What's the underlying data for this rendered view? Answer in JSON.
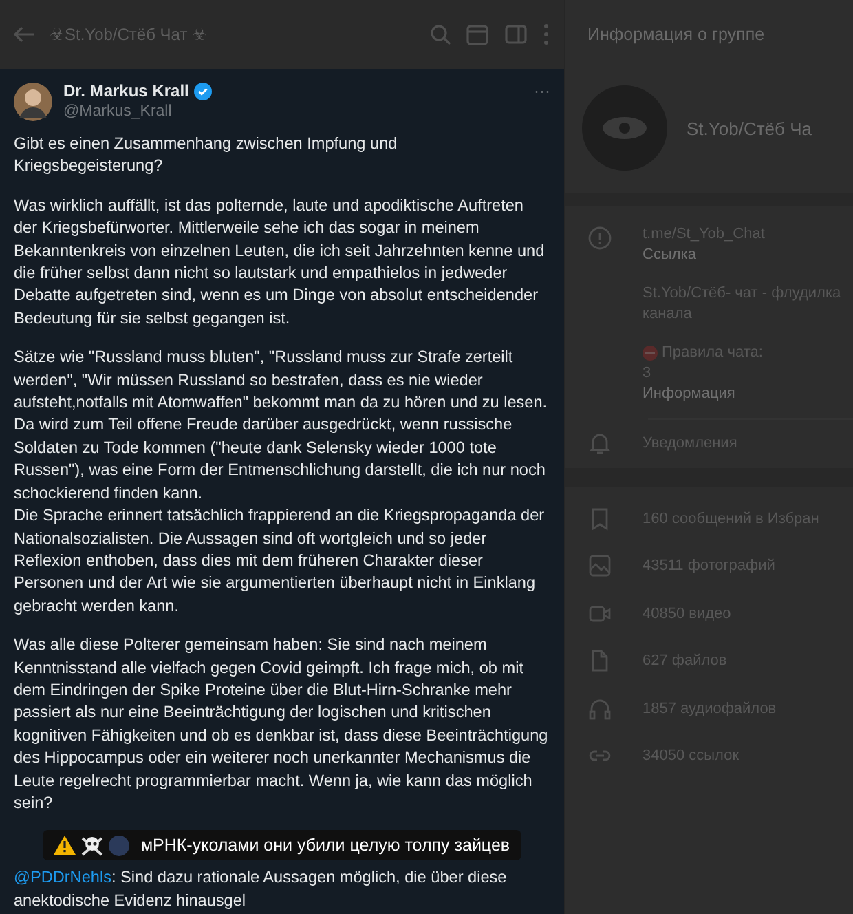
{
  "chat_header": {
    "title": "☣St.Yob/Стёб Чат ☣"
  },
  "tweet": {
    "author": "Dr. Markus Krall",
    "handle": "@Markus_Krall",
    "verified": true,
    "more": "···",
    "paragraphs": [
      "Gibt es einen Zusammenhang zwischen Impfung und Kriegsbegeisterung?",
      "Was wirklich auffällt, ist das polternde, laute und apodiktische Auftreten der Kriegsbefürworter. Mittlerweile sehe ich das sogar in meinem Bekanntenkreis von einzelnen Leuten, die ich seit Jahrzehnten kenne und die früher selbst dann nicht so lautstark und empathielos in jedweder Debatte aufgetreten sind, wenn es um Dinge von absolut entscheidender Bedeutung für sie selbst gegangen ist.",
      "Sätze wie \"Russland muss bluten\", \"Russland muss zur Strafe zerteilt werden\", \"Wir müssen Russland so bestrafen, dass es nie wieder aufsteht,notfalls mit Atomwaffen\" bekommt man da zu hören und zu lesen.\nDa wird zum Teil offene Freude darüber ausgedrückt, wenn russische Soldaten zu Tode kommen (\"heute dank Selensky wieder 1000 tote Russen\"), was eine Form der Entmenschlichung darstellt, die ich nur noch schockierend finden kann.\nDie Sprache erinnert tatsächlich frappierend an die Kriegspropaganda der Nationalsozialisten. Die Aussagen sind oft wortgleich und so jeder Reflexion enthoben, dass dies mit dem früheren Charakter dieser Personen und der Art wie sie argumentierten überhaupt nicht in Einklang gebracht werden kann.",
      "Was alle diese Polterer gemeinsam haben: Sie sind nach meinem Kenntnisstand alle vielfach gegen Covid geimpft. Ich frage mich, ob mit dem Eindringen der Spike Proteine über die Blut-Hirn-Schranke mehr passiert als nur eine Beeinträchtigung der logischen und kritischen kognitiven Fähigkeiten und ob es denkbar ist, dass diese Beeinträchtigung des Hippocampus oder ein weiterer noch unerkannter Mechanismus die Leute regelrecht programmierbar macht. Wenn ja, wie kann das möglich sein?"
    ],
    "quote": {
      "mention": "@PDDrNehls",
      "text": ": Sind dazu rationale Aussagen möglich, die über diese anektodische Evidenz hinausgel"
    }
  },
  "caption": "мРНК-уколами они убили целую толпу зайцев",
  "info_panel": {
    "title": "Информация о группе",
    "group_name": "St.Yob/Стёб Ча",
    "link": "t.me/St_Yob_Chat",
    "link_label": "Ссылка",
    "description": [
      "St.Yob/Стёб- чат - флудилка",
      "канала"
    ],
    "rules": "Правила чата:",
    "rules_number": "3",
    "description_label": "Информация",
    "notifications": "Уведомления",
    "media": [
      {
        "kind": "saved",
        "label": "160 сообщений в Избран"
      },
      {
        "kind": "photos",
        "label": "43511 фотографий"
      },
      {
        "kind": "videos",
        "label": "40850 видео"
      },
      {
        "kind": "files",
        "label": "627 файлов"
      },
      {
        "kind": "audio",
        "label": "1857 аудиофайлов"
      },
      {
        "kind": "links",
        "label": "34050 ссылок"
      }
    ]
  }
}
